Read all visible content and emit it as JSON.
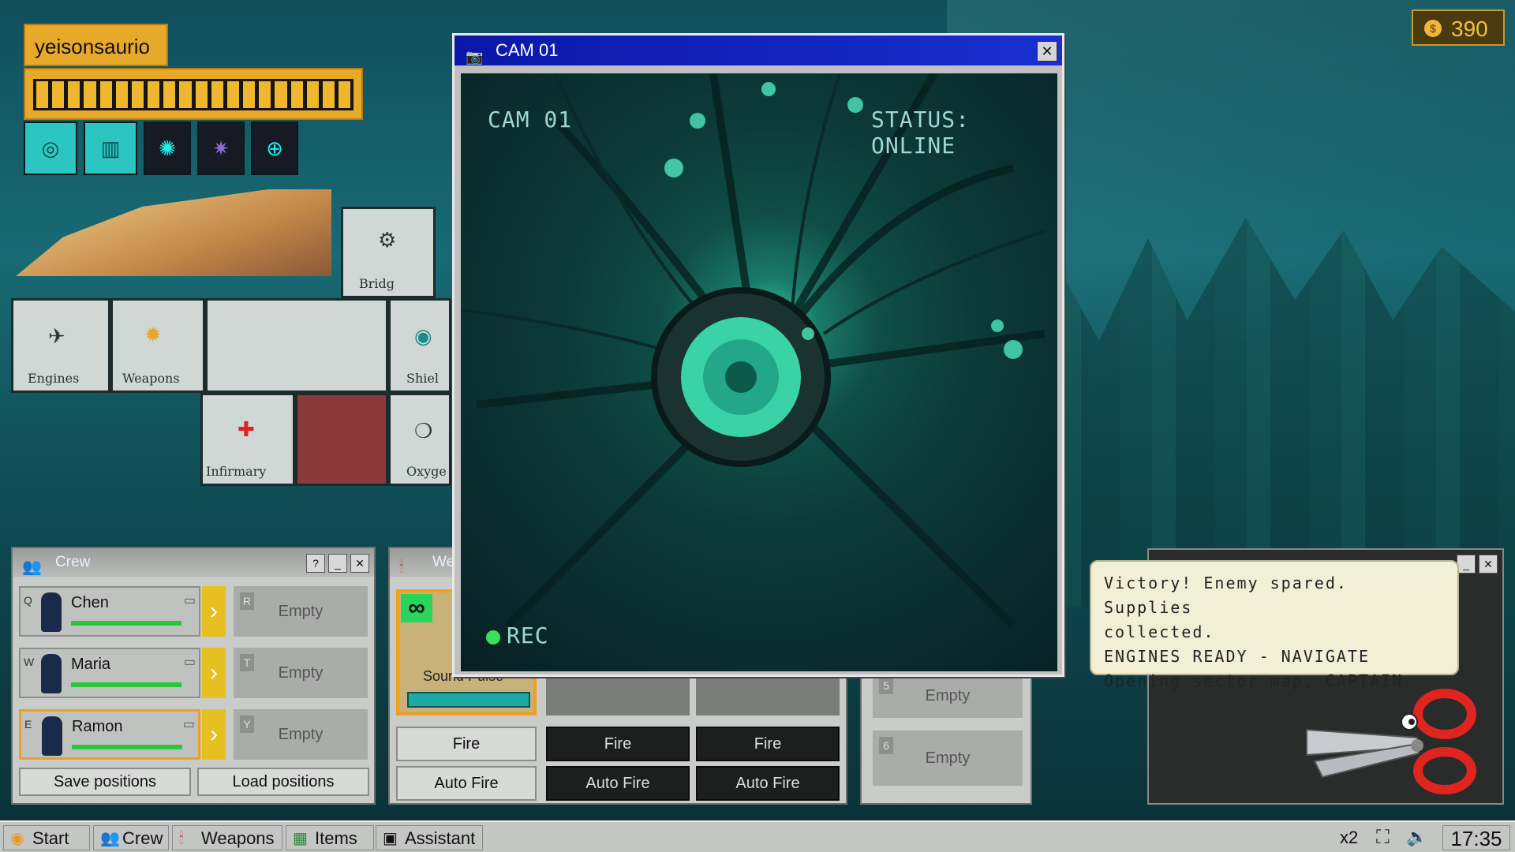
{
  "player": {
    "name": "yeisonsaurio"
  },
  "currency": {
    "amount": "390",
    "icon": "coin-icon"
  },
  "ship_rooms": {
    "bridge": "Bridg",
    "engines": "Engines",
    "weapons": "Weapons",
    "shields": "Shiel",
    "infirmary": "Infirmary",
    "oxygen": "Oxyge"
  },
  "crew_panel": {
    "title": "Crew",
    "members": [
      {
        "key": "Q",
        "name": "Chen",
        "health": 1.0,
        "slot_key": "R",
        "slot_label": "Empty"
      },
      {
        "key": "W",
        "name": "Maria",
        "health": 1.0,
        "slot_key": "T",
        "slot_label": "Empty"
      },
      {
        "key": "E",
        "name": "Ramon",
        "health": 1.0,
        "slot_key": "Y",
        "slot_label": "Empty"
      }
    ],
    "save_label": "Save positions",
    "load_label": "Load positions"
  },
  "weapons_panel": {
    "title": "Wea",
    "weapon_name": "Sound Pulse",
    "infinite_label": "∞",
    "fire_label": "Fire",
    "auto_fire_label": "Auto Fire"
  },
  "items_panel": {
    "slots": [
      {
        "key": "5",
        "label": "Empty"
      },
      {
        "key": "6",
        "label": "Empty"
      }
    ]
  },
  "camera_window": {
    "title": "CAM 01",
    "overlay_cam": "CAM 01",
    "overlay_status": "STATUS: ONLINE",
    "overlay_rec": "REC"
  },
  "assistant": {
    "messages": [
      "Victory! Enemy spared. Supplies",
      "collected.",
      "ENGINES READY - NAVIGATE",
      "Opening sector map, CAPTAIN."
    ]
  },
  "taskbar": {
    "start": "Start",
    "items": [
      "Crew",
      "Weapons",
      "Items",
      "Assistant"
    ],
    "speed": "x2",
    "clock": "17:35"
  },
  "colors": {
    "accent": "#e7a92a",
    "titlebar": "#0a17a8",
    "health": "#29c63c"
  }
}
